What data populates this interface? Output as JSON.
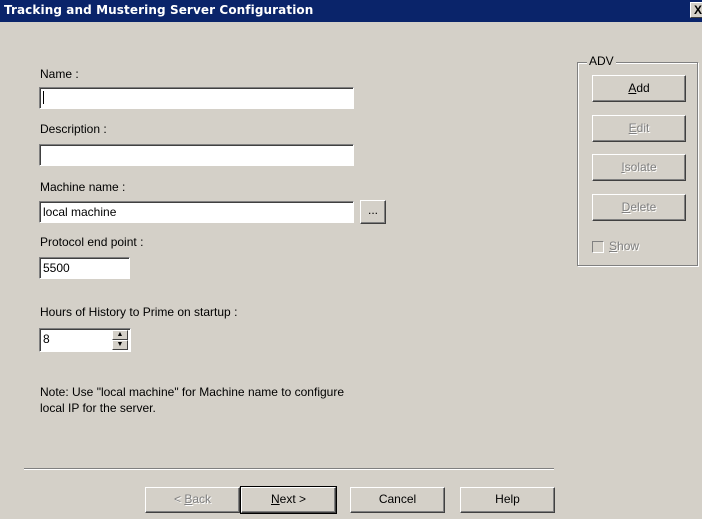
{
  "window": {
    "title": "Tracking and Mustering Server Configuration",
    "close_glyph": "X"
  },
  "form": {
    "name_label": "Name :",
    "name_value": "",
    "description_label": "Description :",
    "description_value": "",
    "machine_name_label": "Machine name :",
    "machine_name_value": "local machine",
    "browse_label": "...",
    "protocol_label": "Protocol end point :",
    "protocol_value": "5500",
    "hours_label": "Hours of History to Prime on startup :",
    "hours_value": "8",
    "note_line1": "Note: Use \"local machine\" for Machine name to configure",
    "note_line2": "local IP for the server."
  },
  "adv": {
    "legend": "ADV",
    "add": {
      "mnemonic": "A",
      "rest": "dd"
    },
    "edit": {
      "mnemonic": "E",
      "rest": "dit"
    },
    "isolate": {
      "mnemonic": "I",
      "rest": "solate"
    },
    "delete": {
      "mnemonic": "D",
      "rest": "elete"
    },
    "show": {
      "mnemonic": "S",
      "rest": "how"
    },
    "show_checked": false
  },
  "footer": {
    "back": {
      "prefix": "< ",
      "mnemonic": "B",
      "rest": "ack"
    },
    "next": {
      "mnemonic": "N",
      "rest": "ext >"
    },
    "cancel": "Cancel",
    "help": "Help"
  }
}
